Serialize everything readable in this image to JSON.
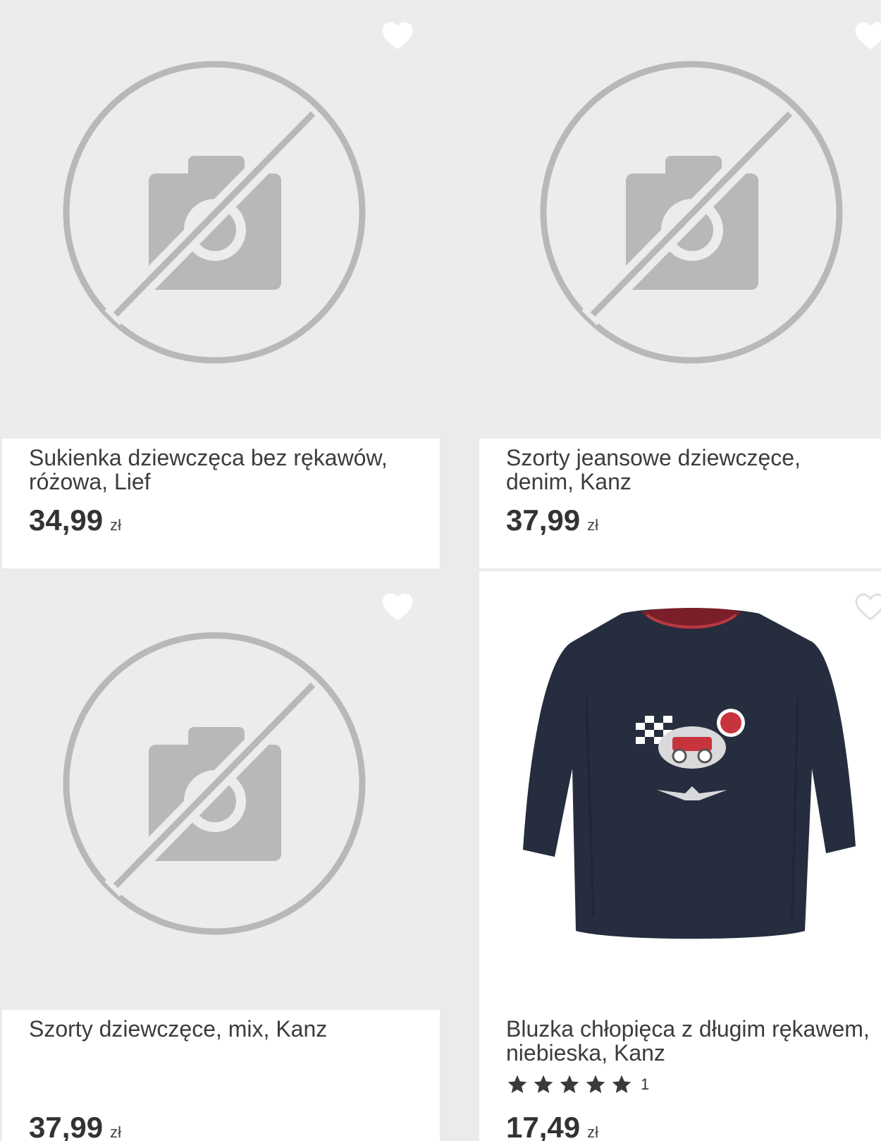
{
  "products": [
    {
      "title": "Sukienka dziewczęca bez rękawów, różowa, Lief",
      "price": "34,99",
      "currency": "zł"
    },
    {
      "title": "Szorty jeansowe dziewczęce, denim, Kanz",
      "price": "37,99",
      "currency": "zł"
    },
    {
      "title": "Szorty dziewczęce, mix, Kanz",
      "price": "37,99",
      "currency": "zł"
    },
    {
      "title": "Bluzka chłopięca z długim rękawem, niebieska, Kanz",
      "price": "17,49",
      "currency": "zł",
      "rating_stars": 5,
      "rating_count": "1"
    }
  ],
  "icons": {
    "favorite": "heart-outline-icon",
    "no_image": "no-photo-icon",
    "rating": "star-icon"
  },
  "colors": {
    "placeholder_bg": "#ececec",
    "placeholder_icon": "#b8b8b8",
    "text": "#3c3c3c",
    "star": "#3a3a3a"
  }
}
